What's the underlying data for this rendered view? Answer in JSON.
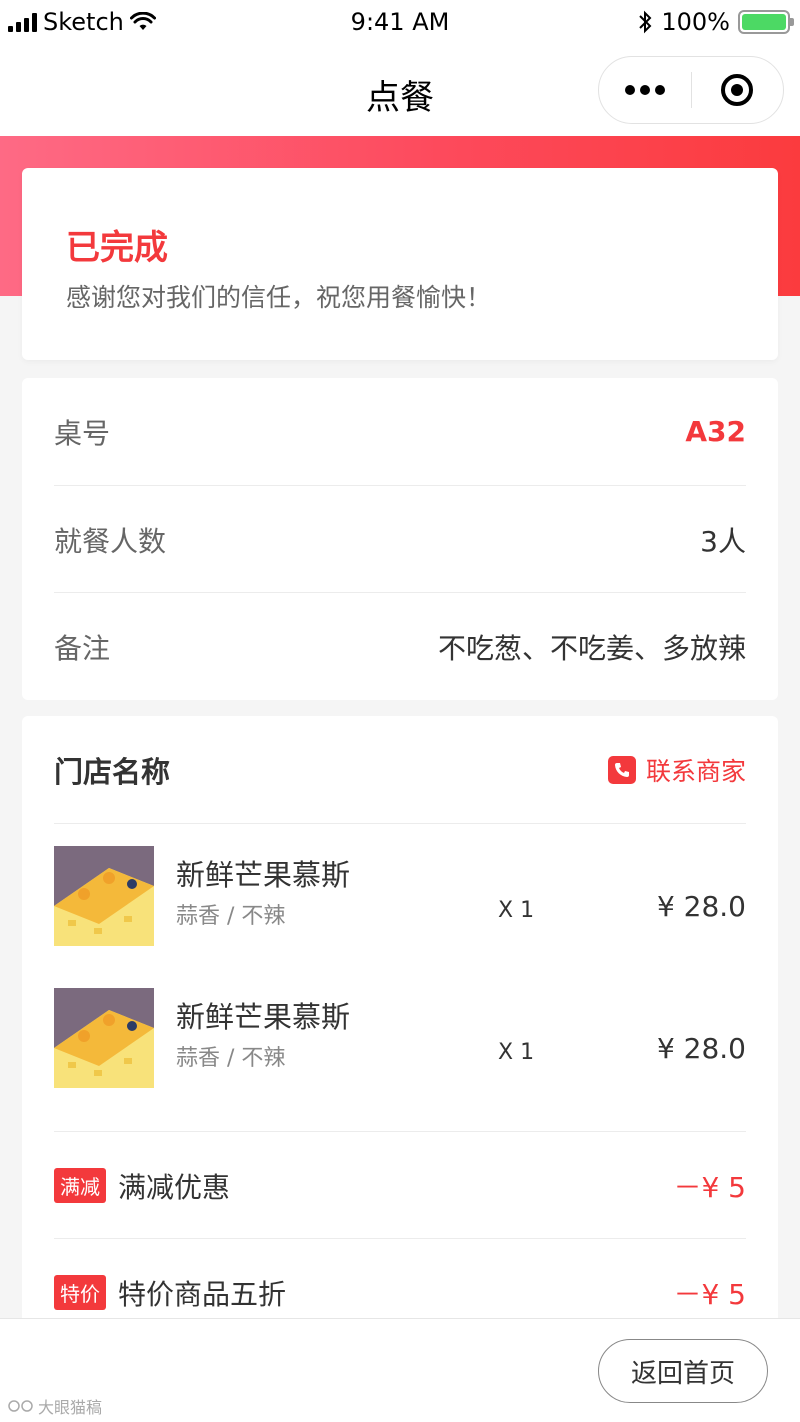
{
  "status_bar": {
    "carrier": "Sketch",
    "time": "9:41 AM",
    "battery": "100%"
  },
  "nav": {
    "title": "点餐"
  },
  "order_status": {
    "title": "已完成",
    "message": "感谢您对我们的信任，祝您用餐愉快！"
  },
  "info": {
    "table_label": "桌号",
    "table_value": "A32",
    "diners_label": "就餐人数",
    "diners_value": "3人",
    "remark_label": "备注",
    "remark_value": "不吃葱、不吃姜、多放辣"
  },
  "store": {
    "name": "门店名称",
    "contact_label": "联系商家"
  },
  "items": [
    {
      "name": "新鲜芒果慕斯",
      "spec": "蒜香 / 不辣",
      "qty": "X 1",
      "price": "¥ 28.0"
    },
    {
      "name": "新鲜芒果慕斯",
      "spec": "蒜香 / 不辣",
      "qty": "X 1",
      "price": "¥ 28.0"
    }
  ],
  "promotions": [
    {
      "tag": "满减",
      "label": "满减优惠",
      "amount": "－¥ 5"
    },
    {
      "tag": "特价",
      "label": "特价商品五折",
      "amount": "－¥ 5"
    }
  ],
  "bottom": {
    "home_button": "返回首页"
  },
  "watermark": "大眼猫稿",
  "colors": {
    "accent": "#f3393c",
    "banner_start": "#fe6a85",
    "banner_end": "#fb3b3e"
  }
}
